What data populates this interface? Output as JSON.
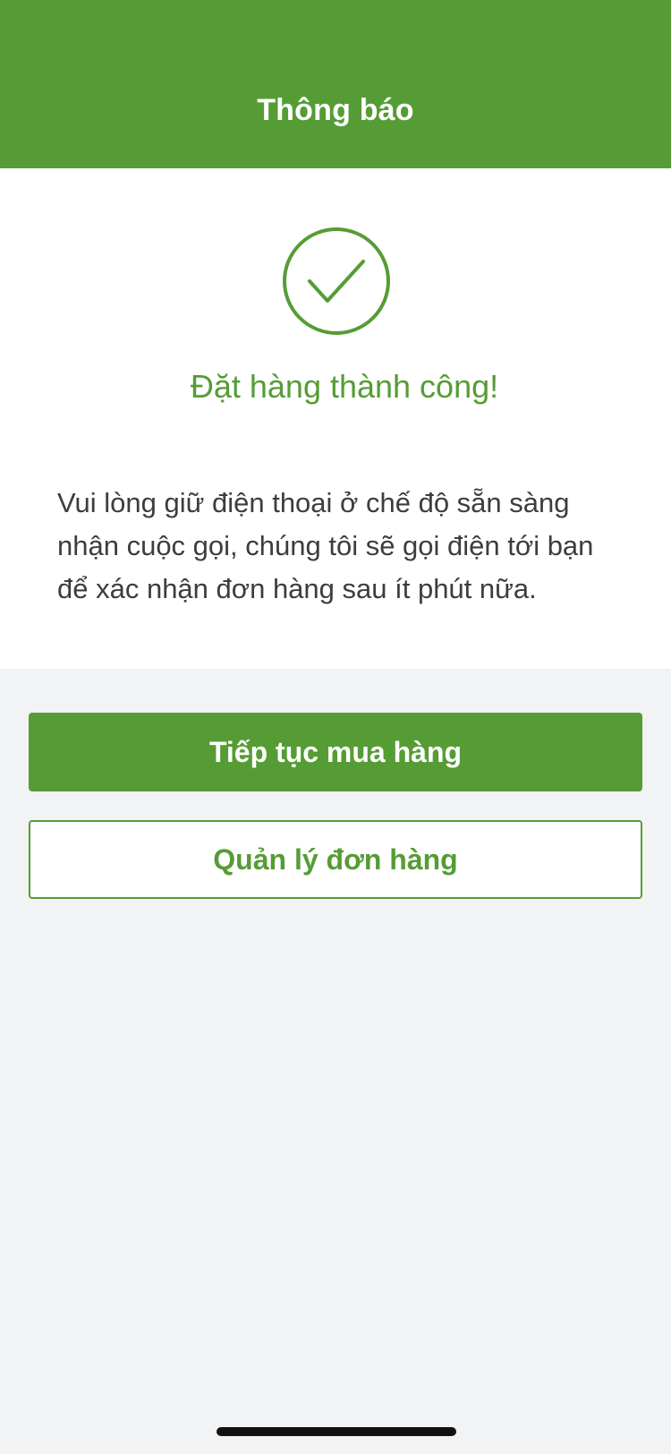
{
  "header": {
    "title": "Thông báo"
  },
  "success": {
    "icon": "checkmark-circle-icon",
    "title": "Đặt hàng thành công!",
    "message": "Vui lòng giữ điện thoại ở chế độ sẵn sàng nhận cuộc gọi, chúng tôi sẽ gọi điện tới bạn để xác nhận đơn hàng sau ít phút nữa."
  },
  "actions": {
    "continue_label": "Tiếp tục mua hàng",
    "manage_label": "Quản lý đơn hàng"
  },
  "colors": {
    "brand_green": "#569c35",
    "background": "#f1f3f5",
    "text": "#3d3d3d"
  }
}
